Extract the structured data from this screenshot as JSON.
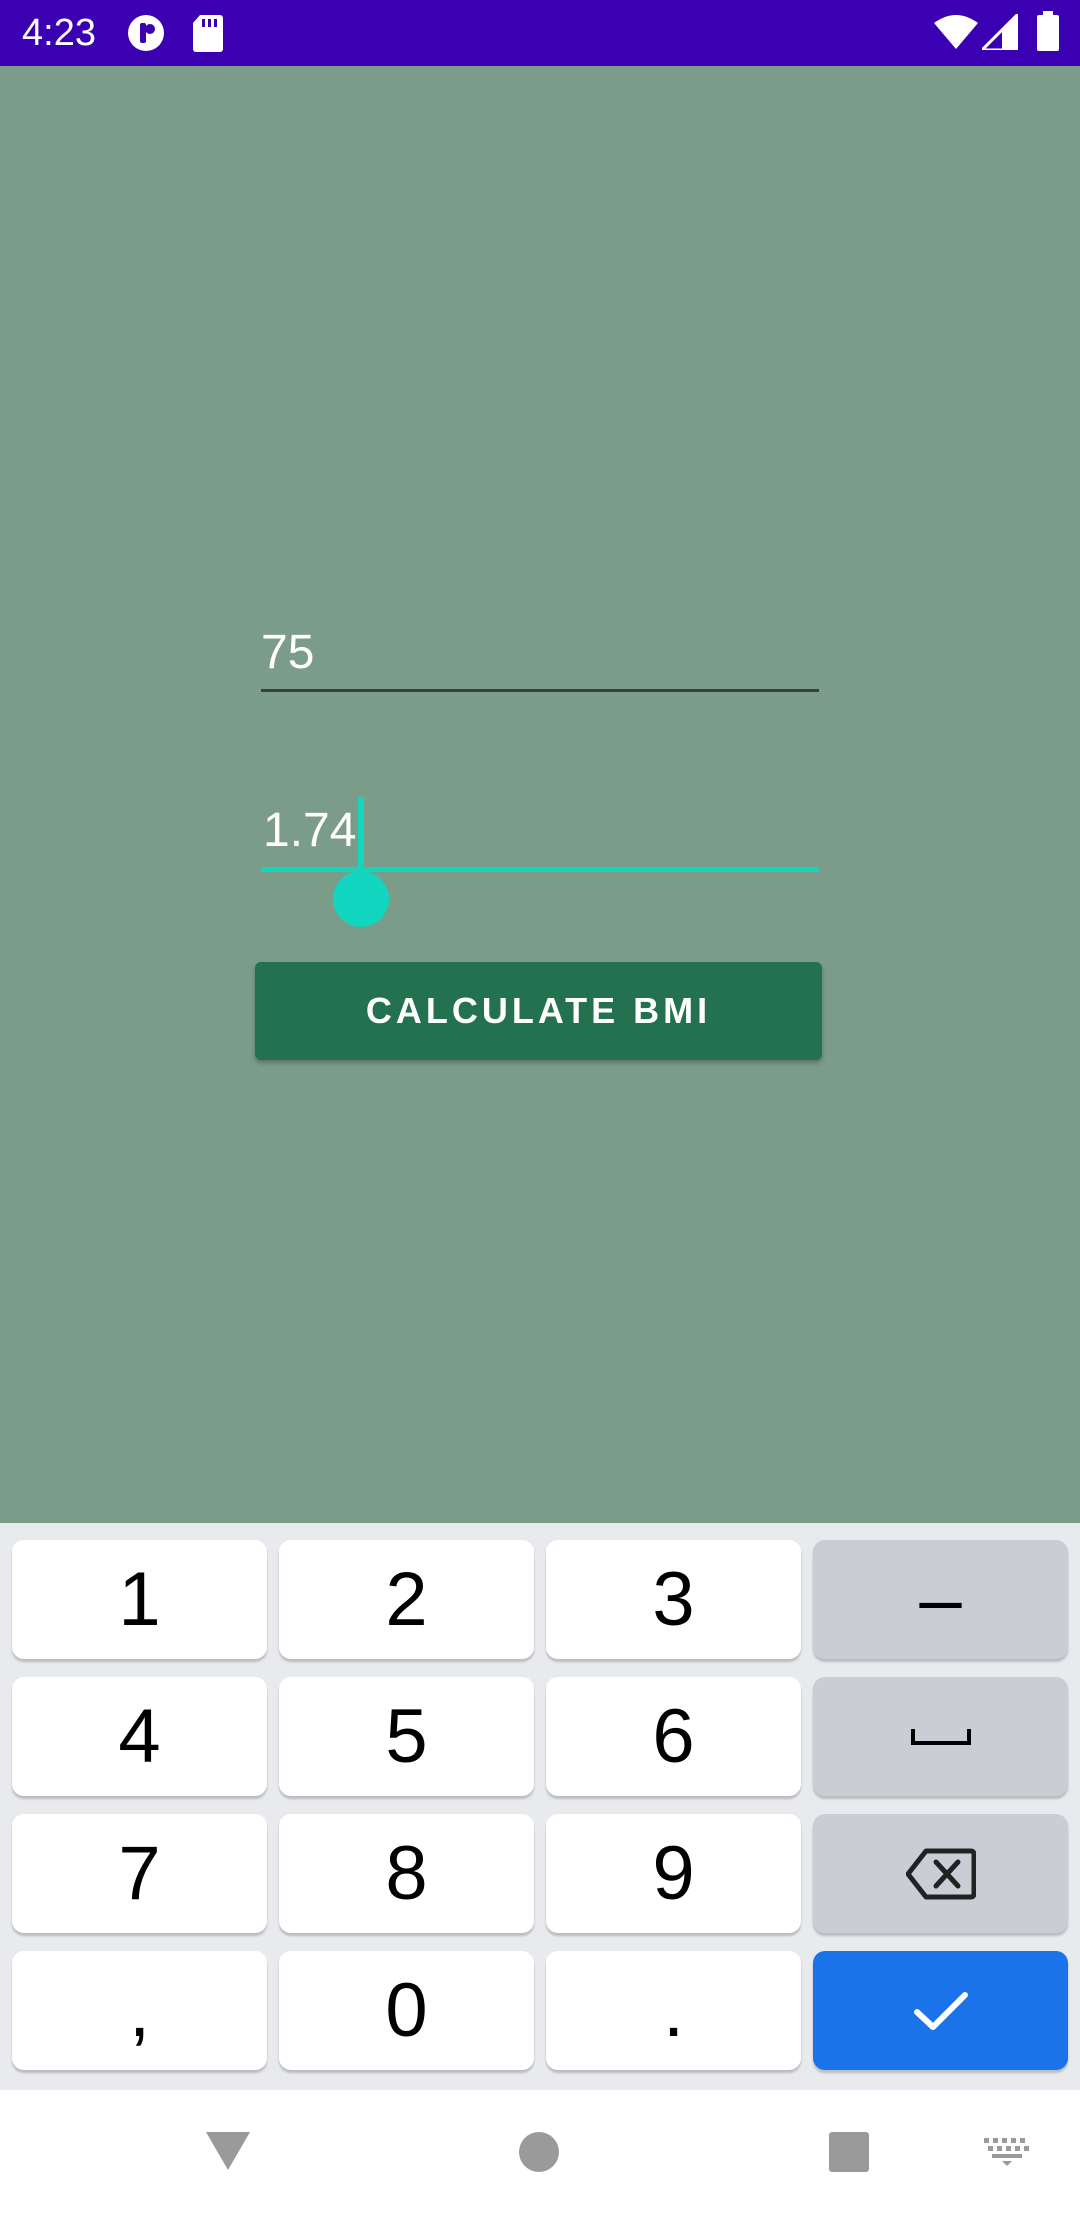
{
  "status_bar": {
    "time": "4:23",
    "icons": [
      "app-notification-icon",
      "sd-card-icon",
      "wifi-icon",
      "signal-icon",
      "battery-icon"
    ]
  },
  "form": {
    "weight_value": "75",
    "height_value": "1.74",
    "calculate_label": "CALCULATE BMI"
  },
  "colors": {
    "background": "#7a9c88",
    "status_bar": "#3a00b1",
    "accent": "#13d6c0",
    "button": "#24714f",
    "keyboard_done": "#1a73e8"
  },
  "keyboard": {
    "keys": [
      "1",
      "2",
      "3",
      "–",
      "4",
      "5",
      "6",
      "space",
      "7",
      "8",
      "9",
      "backspace",
      ",",
      "0",
      ".",
      "done"
    ]
  },
  "nav_bar": {
    "icons": [
      "back-icon",
      "home-icon",
      "recents-icon",
      "keyboard-switch-icon"
    ]
  }
}
